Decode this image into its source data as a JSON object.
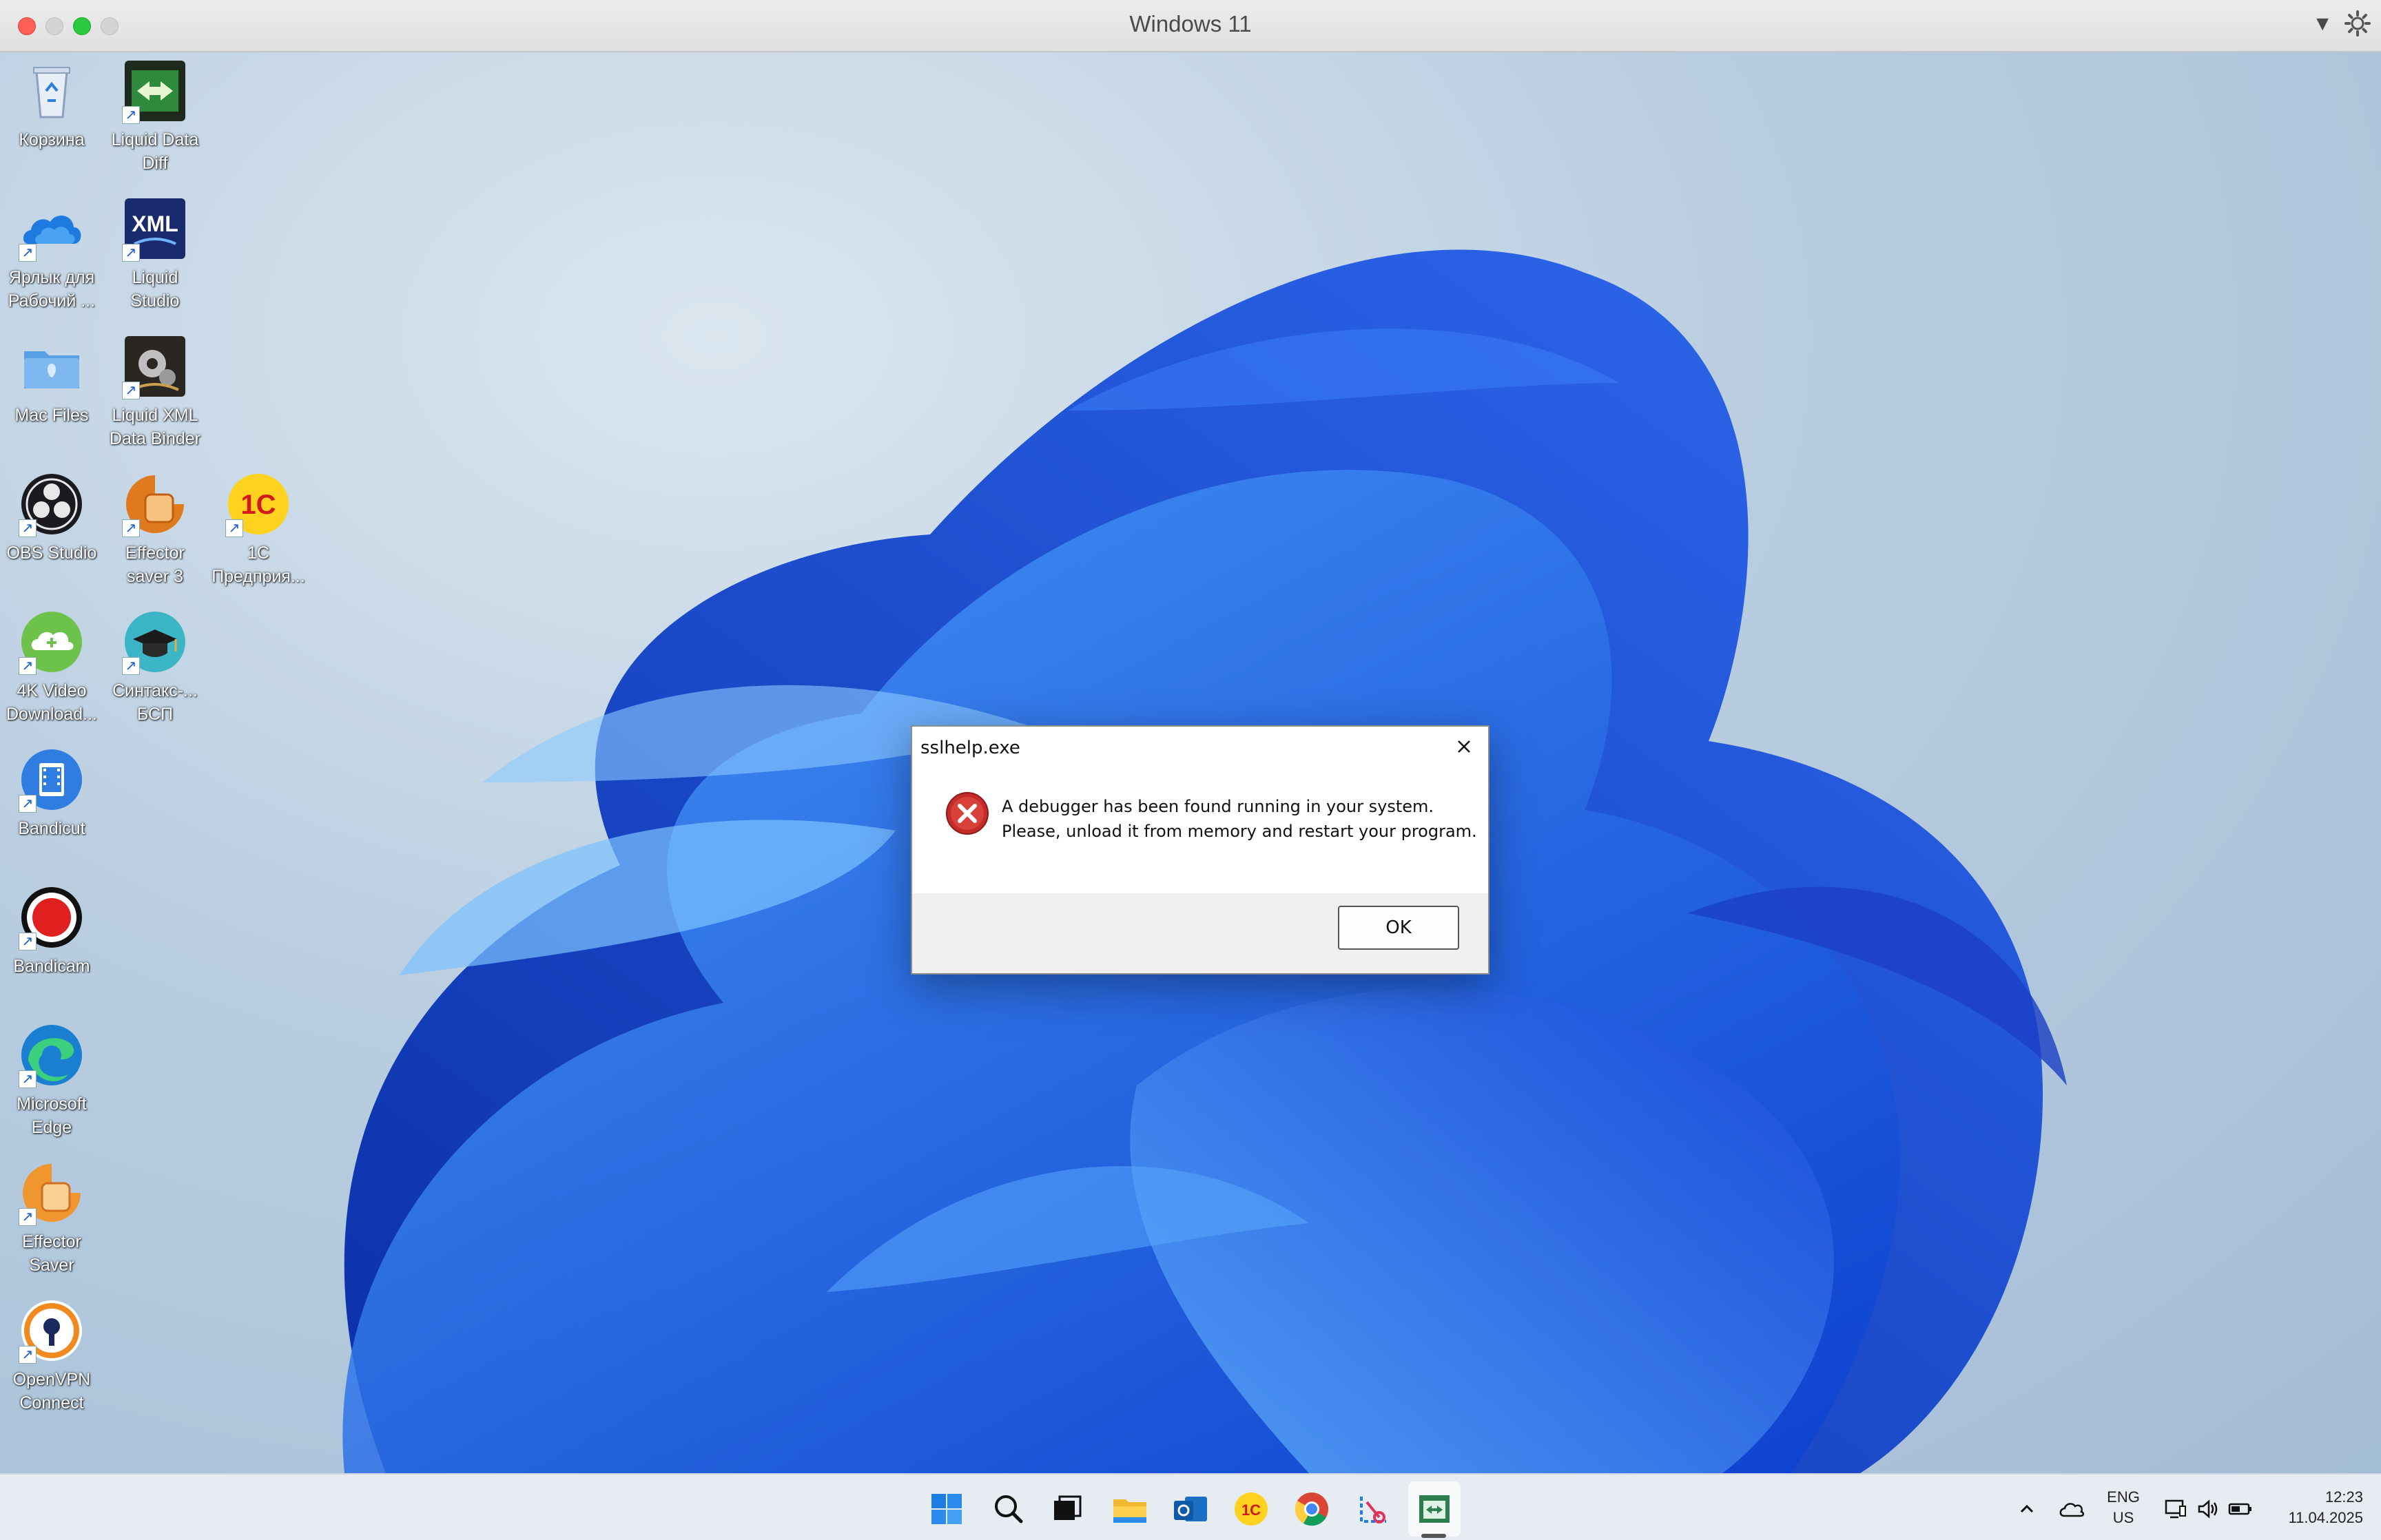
{
  "window": {
    "title": "Windows 11"
  },
  "desktop_icons": [
    {
      "label": "Корзина",
      "icon": "recycle-bin-icon"
    },
    {
      "label": "Liquid Data\nDiff",
      "icon": "liquid-data-diff-icon"
    },
    {
      "label": "Ярлык для\nРабочий ...",
      "icon": "onedrive-icon"
    },
    {
      "label": "Liquid\nStudio",
      "icon": "liquid-studio-xml-icon"
    },
    {
      "label": "Mac Files",
      "icon": "mac-folder-icon"
    },
    {
      "label": "Liquid XML\nData Binder",
      "icon": "liquid-xml-data-binder-icon"
    },
    {
      "label": "OBS Studio",
      "icon": "obs-studio-icon"
    },
    {
      "label": "Effector\nsaver 3",
      "icon": "effector-saver-3-icon"
    },
    {
      "label": "1C\nПредприя...",
      "icon": "1c-enterprise-icon"
    },
    {
      "label": "4K Video\nDownload...",
      "icon": "4k-video-downloader-icon"
    },
    {
      "label": "Синтакс-...\nБСП",
      "icon": "syntax-bsp-icon"
    },
    {
      "label": "Bandicut",
      "icon": "bandicut-icon"
    },
    {
      "label": "Bandicam",
      "icon": "bandicam-icon"
    },
    {
      "label": "Microsoft\nEdge",
      "icon": "edge-icon"
    },
    {
      "label": "Effector\nSaver",
      "icon": "effector-saver-icon"
    },
    {
      "label": "OpenVPN\nConnect",
      "icon": "openvpn-icon"
    }
  ],
  "dialog": {
    "title": "sslhelp.exe",
    "message_line1": "A debugger has been found running in your system.",
    "message_line2": "Please, unload it from memory and restart your program.",
    "ok_label": "OK"
  },
  "taskbar": {
    "items": [
      "start-icon",
      "search-icon",
      "task-view-icon",
      "file-explorer-icon",
      "outlook-icon",
      "1c-icon",
      "chrome-icon",
      "snipping-tool-icon",
      "active-app-icon"
    ],
    "lang_line1": "ENG",
    "lang_line2": "US",
    "time": "12:23",
    "date": "11.04.2025"
  }
}
